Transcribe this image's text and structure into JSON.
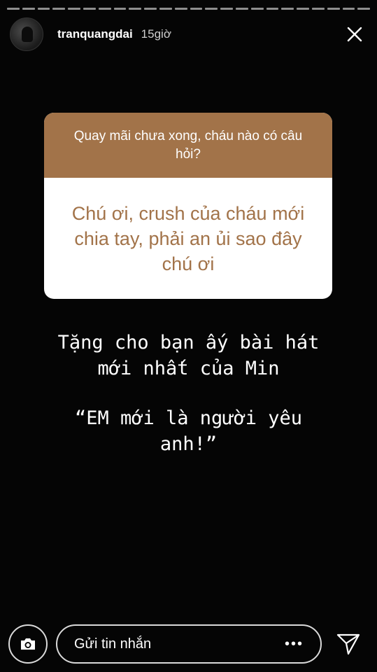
{
  "progress": {
    "segments": 24
  },
  "header": {
    "username": "tranquangdai",
    "time": "15giờ"
  },
  "question_card": {
    "prompt": "Quay mãi chưa xong, cháu nào có câu hỏi?",
    "answer": "Chú ơi, crush của cháu mới chia tay, phải an ủi sao đây chú ơi",
    "accent": "#a27349"
  },
  "overlay_text": {
    "line1": "Tặng cho bạn ấy bài hát\nmới nhất của Min",
    "line2": "“EM mới là người yêu\nanh!”"
  },
  "footer": {
    "message_placeholder": "Gửi tin nhắn",
    "more_label": "•••"
  },
  "icons": {
    "close": "close-icon",
    "camera": "camera-icon",
    "send": "send-icon"
  }
}
